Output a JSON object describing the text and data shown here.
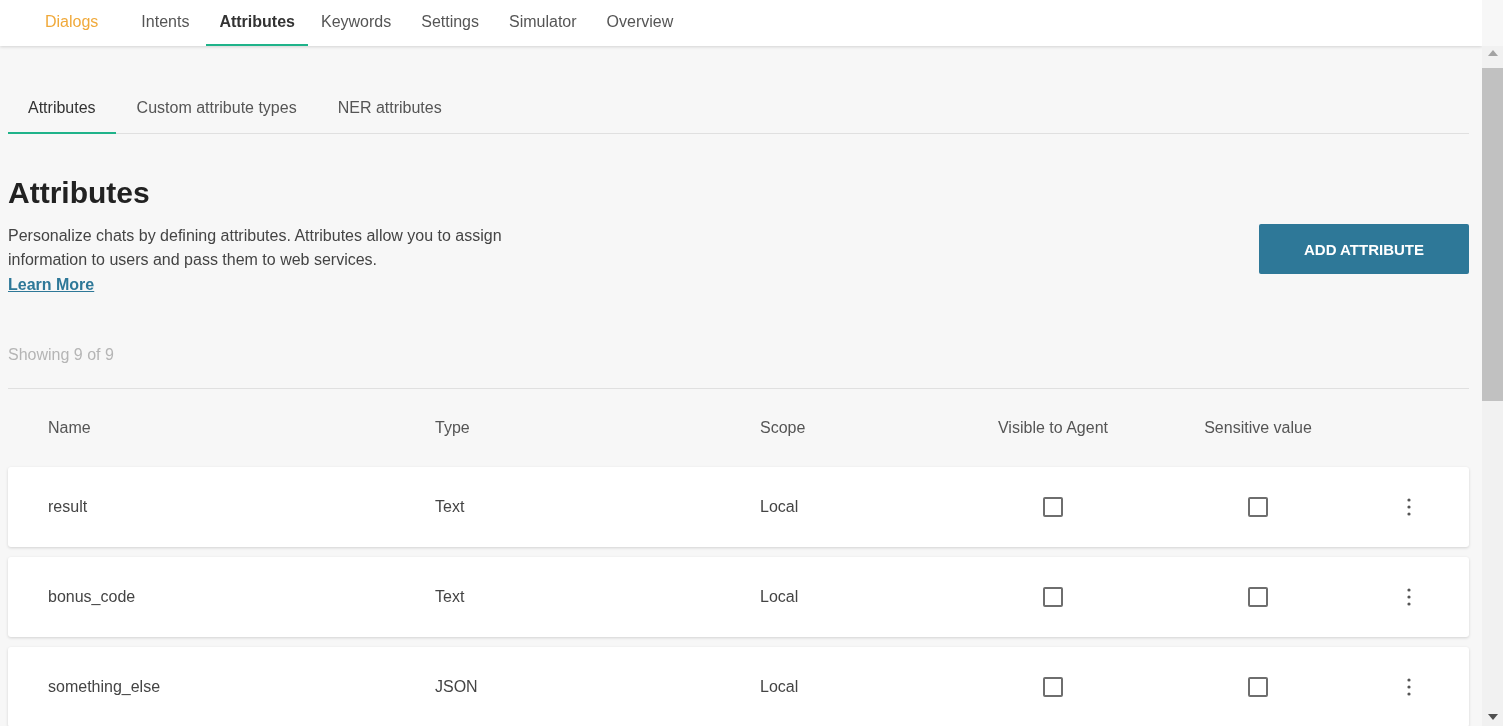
{
  "nav": {
    "items": [
      {
        "label": "Dialogs",
        "highlighted": true,
        "selected": false
      },
      {
        "label": "Intents",
        "highlighted": false,
        "selected": false
      },
      {
        "label": "Attributes",
        "highlighted": false,
        "selected": true
      },
      {
        "label": "Keywords",
        "highlighted": false,
        "selected": false
      },
      {
        "label": "Settings",
        "highlighted": false,
        "selected": false
      },
      {
        "label": "Simulator",
        "highlighted": false,
        "selected": false
      },
      {
        "label": "Overview",
        "highlighted": false,
        "selected": false
      }
    ]
  },
  "subtabs": [
    {
      "label": "Attributes",
      "selected": true
    },
    {
      "label": "Custom attribute types",
      "selected": false
    },
    {
      "label": "NER attributes",
      "selected": false
    }
  ],
  "heading": "Attributes",
  "description": "Personalize chats by defining attributes. Attributes allow you to assign information to users and pass them to web services.",
  "learn_more": "Learn More",
  "add_button": "ADD ATTRIBUTE",
  "count": "Showing 9 of 9",
  "table": {
    "columns": [
      "Name",
      "Type",
      "Scope",
      "Visible to Agent",
      "Sensitive value"
    ],
    "rows": [
      {
        "name": "result",
        "type": "Text",
        "scope": "Local",
        "visible": false,
        "sensitive": false
      },
      {
        "name": "bonus_code",
        "type": "Text",
        "scope": "Local",
        "visible": false,
        "sensitive": false
      },
      {
        "name": "something_else",
        "type": "JSON",
        "scope": "Local",
        "visible": false,
        "sensitive": false
      }
    ]
  }
}
